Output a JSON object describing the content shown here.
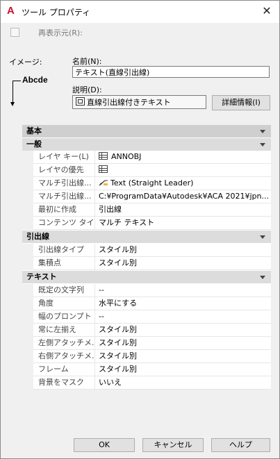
{
  "window": {
    "title": "ツール プロパティ",
    "app_icon": "A",
    "close": "✕"
  },
  "redisplay": {
    "label": "再表示元(R):"
  },
  "image": {
    "label": "イメージ:",
    "preview_text": "Abcde"
  },
  "name": {
    "label": "名前(N):",
    "value": "テキスト(直線引出線)"
  },
  "description": {
    "label": "説明(D):",
    "value": "直線引出線付きテキスト",
    "detail_button": "詳細情報(I)"
  },
  "grid": {
    "root": {
      "label": "基本"
    },
    "general": {
      "label": "一般",
      "rows": [
        {
          "key": "レイヤ キー(L)",
          "value": "ANNOBJ",
          "icon": "layer-icon"
        },
        {
          "key": "レイヤの優先",
          "value": "",
          "icon": "layer-icon"
        },
        {
          "key": "マルチ引出線...",
          "value": "Text (Straight Leader)",
          "icon": "leader-icon"
        },
        {
          "key": "マルチ引出線...",
          "value": "C:¥ProgramData¥Autodesk¥ACA  2021¥jpn..."
        },
        {
          "key": "最初に作成",
          "value": "引出線"
        },
        {
          "key": "コンテンツ タイプ",
          "value": "マルチ テキスト"
        }
      ]
    },
    "leader": {
      "label": "引出線",
      "rows": [
        {
          "key": "引出線タイプ",
          "value": "スタイル別"
        },
        {
          "key": "集積点",
          "value": "スタイル別"
        }
      ]
    },
    "text": {
      "label": "テキスト",
      "rows": [
        {
          "key": "既定の文字列",
          "value": "--"
        },
        {
          "key": "角度",
          "value": "水平にする"
        },
        {
          "key": "幅のプロンプト",
          "value": "--"
        },
        {
          "key": "常に左揃え",
          "value": "スタイル別"
        },
        {
          "key": "左側アタッチメ...",
          "value": "スタイル別"
        },
        {
          "key": "右側アタッチメ...",
          "value": "スタイル別"
        },
        {
          "key": "フレーム",
          "value": "スタイル別"
        },
        {
          "key": "背景をマスク",
          "value": "いいえ"
        }
      ]
    }
  },
  "buttons": {
    "ok": "OK",
    "cancel": "キャンセル",
    "help": "ヘルプ"
  }
}
